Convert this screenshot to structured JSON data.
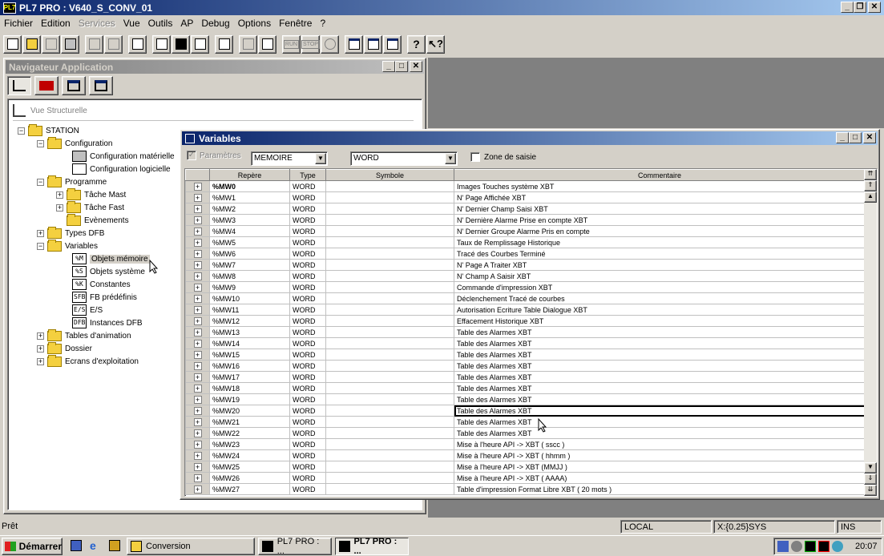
{
  "app": {
    "title": "PL7 PRO : V640_S_CONV_01",
    "icon": "PL7"
  },
  "menu": [
    "Fichier",
    "Edition",
    "Services",
    "Vue",
    "Outils",
    "AP",
    "Debug",
    "Options",
    "Fenêtre",
    "?"
  ],
  "toolbar": {
    "run": "RUN",
    "stop": "STOP"
  },
  "navigator": {
    "title": "Navigateur Application",
    "view_label": "Vue Structurelle",
    "tree": {
      "station": "STATION",
      "configuration": "Configuration",
      "config_materielle": "Configuration matérielle",
      "config_logicielle": "Configuration logicielle",
      "programme": "Programme",
      "tache_mast": "Tâche Mast",
      "tache_fast": "Tâche Fast",
      "evenements": "Evènements",
      "types_dfb": "Types DFB",
      "variables": "Variables",
      "objets_memoire": "Objets mémoire",
      "objets_systeme": "Objets système",
      "constantes": "Constantes",
      "fb_predefinis": "FB prédéfinis",
      "es": "E/S",
      "instances_dfb": "Instances DFB",
      "tables_animation": "Tables d'animation",
      "dossier": "Dossier",
      "ecrans": "Ecrans d'exploitation"
    },
    "type_icons": {
      "mem": "%M",
      "sys": "%S",
      "const": "%K",
      "fb": "SFB",
      "es": "E/S",
      "dfb": "DFB"
    }
  },
  "variables": {
    "title": "Variables",
    "parametres_label": "Paramètres",
    "memory_select": "MEMOIRE",
    "type_select": "WORD",
    "zone_label": "Zone de saisie",
    "columns": [
      "Repère",
      "Type",
      "Symbole",
      "Commentaire"
    ],
    "rows": [
      [
        "%MW0",
        "WORD",
        "",
        "Images Touches système XBT"
      ],
      [
        "%MW1",
        "WORD",
        "",
        "N' Page Affichée XBT"
      ],
      [
        "%MW2",
        "WORD",
        "",
        "N' Dernier Champ Saisi XBT"
      ],
      [
        "%MW3",
        "WORD",
        "",
        "N' Dernière Alarme Prise en compte XBT"
      ],
      [
        "%MW4",
        "WORD",
        "",
        "N' Dernier Groupe Alarme Pris en compte"
      ],
      [
        "%MW5",
        "WORD",
        "",
        "Taux de Remplissage Historique"
      ],
      [
        "%MW6",
        "WORD",
        "",
        "Tracé des Courbes Terminé"
      ],
      [
        "%MW7",
        "WORD",
        "",
        "N' Page A Traiter XBT"
      ],
      [
        "%MW8",
        "WORD",
        "",
        "N' Champ A Saisir XBT"
      ],
      [
        "%MW9",
        "WORD",
        "",
        "Commande d'impression XBT"
      ],
      [
        "%MW10",
        "WORD",
        "",
        "Déclenchement Tracé de courbes"
      ],
      [
        "%MW11",
        "WORD",
        "",
        "Autorisation Ecriture Table Dialogue XBT"
      ],
      [
        "%MW12",
        "WORD",
        "",
        "Effacement Historique XBT"
      ],
      [
        "%MW13",
        "WORD",
        "",
        "Table des Alarmes XBT"
      ],
      [
        "%MW14",
        "WORD",
        "",
        "Table des Alarmes XBT"
      ],
      [
        "%MW15",
        "WORD",
        "",
        "Table des Alarmes XBT"
      ],
      [
        "%MW16",
        "WORD",
        "",
        "Table des Alarmes XBT"
      ],
      [
        "%MW17",
        "WORD",
        "",
        "Table des Alarmes XBT"
      ],
      [
        "%MW18",
        "WORD",
        "",
        "Table des Alarmes XBT"
      ],
      [
        "%MW19",
        "WORD",
        "",
        "Table des Alarmes XBT"
      ],
      [
        "%MW20",
        "WORD",
        "",
        "Table des Alarmes XBT"
      ],
      [
        "%MW21",
        "WORD",
        "",
        "Table des Alarmes XBT"
      ],
      [
        "%MW22",
        "WORD",
        "",
        "Table des Alarmes XBT"
      ],
      [
        "%MW23",
        "WORD",
        "",
        "Mise à l'heure API -> XBT ( sscc )"
      ],
      [
        "%MW24",
        "WORD",
        "",
        "Mise à l'heure API -> XBT ( hhmm )"
      ],
      [
        "%MW25",
        "WORD",
        "",
        "Mise à l'heure API -> XBT (MMJJ )"
      ],
      [
        "%MW26",
        "WORD",
        "",
        "Mise à l'heure API -> XBT ( AAAA)"
      ],
      [
        "%MW27",
        "WORD",
        "",
        "Table d'impression Format Libre XBT ( 20 mots )"
      ]
    ]
  },
  "status": {
    "ready": "Prêt",
    "mode": "LOCAL",
    "address": "X:{0.25}SYS",
    "ins": "INS"
  },
  "taskbar": {
    "start": "Démarrer",
    "task1": "Conversion",
    "task2": "PL7 PRO : ...",
    "task3": "PL7 PRO : ...",
    "clock": "20:07"
  }
}
